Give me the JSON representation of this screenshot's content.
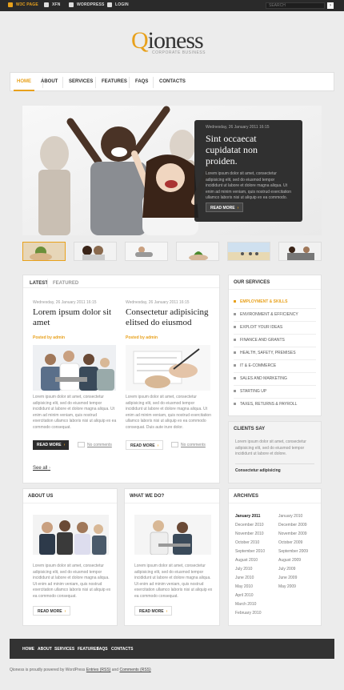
{
  "topbar": {
    "links": [
      "W3C PAGE",
      "XFN",
      "WORDPRESS",
      "LOGIN"
    ],
    "search_placeholder": "SEARCH",
    "search_go": "›"
  },
  "logo": {
    "first": "Q",
    "rest": "ioness",
    "tagline": "CORPORATE BUSINESS"
  },
  "nav": [
    "HOME",
    "ABOUT",
    "SERVICES",
    "FEATURES",
    "FAQS",
    "CONTACTS"
  ],
  "slider": {
    "date": "Wednesday, 26 January 2011 16:15",
    "title": "Sint occaecat cupidatat non proiden.",
    "text": "Lorem ipsum dolor sit amet, consectetur adipisicing elit, sed do eiusmod tempor incididunt ut labore et dolore magna aliqua. Ut enim ad minim veniam, quis nostrud exercitation ullamco laboris nisi ut aliquip ex ea commodo.",
    "button": "READ MORE"
  },
  "tabs": [
    "LATEST",
    "FEATURED"
  ],
  "posts": [
    {
      "date": "Wednesday, 26 January 2011 16:15",
      "title": "Lorem ipsum dolor sit amet",
      "posted": "Posted by admin",
      "text": "Lorem ipsum dolor sit amet, consectetur adipisicing elit, sed do eiusmod tempor incididunt ut labore et dolore magna aliqua. Ut enim ad minim veniam, quis nostrud exercitation ullamco laboris nisi ut aliquip ex ea commodo consequat.",
      "button": "READ MORE",
      "comments": "No comments"
    },
    {
      "date": "Wednesday, 26 January 2011 16:15",
      "title": "Consectetur adipisicing elitsed do eiusmod",
      "posted": "Posted by admin",
      "text": "Lorem ipsum dolor sit amet, consectetur adipisicing elit, sed do eiusmod tempor incididunt ut labore et dolore magna aliqua. Ut enim ad minim veniam, quis nostrud exercitation ullamco laboris nisi ut aliquip ex ea commodo consequat. Duis aute irure dolor.",
      "button": "READ MORE",
      "comments": "No comments"
    }
  ],
  "see_all": "See all",
  "services": {
    "title": "OUR SERVICES",
    "items": [
      "EMPLOYMENT & SKILLS",
      "ENVIRONMENT & EFFICIENCY",
      "EXPLOIT YOUR IDEAS",
      "FINANCE AND GRANTS",
      "HEALTH, SAFETY, PREMISES",
      "IT & E-COMMERCE",
      "SALES AND MARKETING",
      "STARTING UP",
      "TAXES, RETURNS & PAYROLL"
    ]
  },
  "clients": {
    "title": "CLIENTS SAY",
    "text": "Lorem ipsum dolor sit amet, consectetur adipisicing elit, sed do eiusmod tempor incididunt ut labore et dolore.",
    "author": "Consectetur adipisicing"
  },
  "about": {
    "title": "ABOUT US",
    "text": "Lorem ipsum dolor sit amet, consectetur adipisicing elit, sed do eiusmod tempor incididunt ut labore et dolore magna aliqua. Ut enim ad minim veniam, quis nostrud exercitation ullamco laboris nisi ut aliquip ex ea commodo consequat.",
    "button": "READ MORE"
  },
  "whatwedo": {
    "title": "WHAT WE DO?",
    "text": "Lorem ipsum dolor sit amet, consectetur adipisicing elit, sed do eiusmod tempor incididunt ut labore et dolore magna aliqua. Ut enim ad minim veniam, quis nostrud exercitation ullamco laboris nisi ut aliquip ex ea commodo consequat.",
    "button": "READ MORE"
  },
  "archives": {
    "title": "ARCHIVES",
    "col1": [
      "January 2011",
      "December 2010",
      "November 2010",
      "October 2010",
      "September 2010",
      "August 2010",
      "July 2010",
      "June 2010",
      "May 2010",
      "April 2010",
      "March 2010",
      "February 2010"
    ],
    "col2": [
      "January 2010",
      "December 2009",
      "November 2009",
      "October 2009",
      "September 2009",
      "August 2009",
      "July 2009",
      "June 2009",
      "May 2009"
    ]
  },
  "footer": {
    "links": [
      "HOME",
      "ABOUT",
      "SERVICES",
      "FEATURES",
      "FAQS",
      "CONTACTS"
    ],
    "copy_prefix": "Qioness is proudly powered by WordPress",
    "copy_link1": "Entries (RSS)",
    "copy_mid": "and",
    "copy_link2": "Comments (RSS)"
  },
  "colors": {
    "accent": "#e8a11c",
    "dark": "#2a2a2a"
  }
}
